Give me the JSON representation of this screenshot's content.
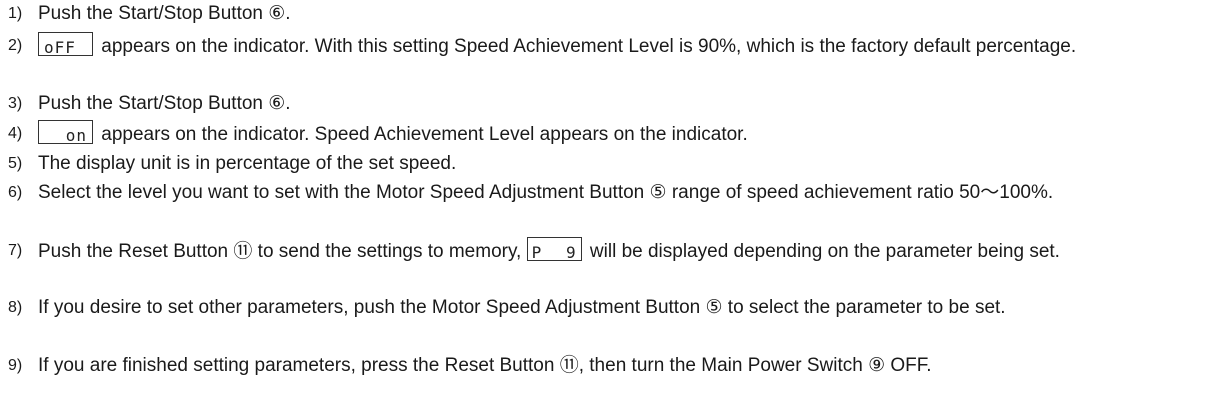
{
  "steps": [
    {
      "num": "1)",
      "text": "Push the Start/Stop Button ⑥."
    },
    {
      "num": "2)",
      "indicator": "oFF",
      "text": "appears on the indicator. With this setting Speed Achievement Level is 90%, which is the factory default percentage."
    },
    {
      "num": "3)",
      "text": "Push the Start/Stop Button ⑥."
    },
    {
      "num": "4)",
      "indicator": "on",
      "text": "appears on the indicator. Speed Achievement Level appears on the indicator."
    },
    {
      "num": "5)",
      "text": "The display unit is in percentage of the set speed."
    },
    {
      "num": "6)",
      "text": "Select the level you want to set with the Motor Speed Adjustment Button ⑤ range of speed achievement ratio 50～100%."
    },
    {
      "num": "7)",
      "text_before": "Push the Reset Button ⑪ to send the settings to memory,",
      "indicator_left": "P",
      "indicator_right": "9",
      "text_after": "will be displayed depending on the parameter being set."
    },
    {
      "num": "8)",
      "text": "If you desire to set other parameters, push the Motor Speed Adjustment Button ⑤ to select the parameter to be set."
    },
    {
      "num": "9)",
      "text": "If you are finished setting parameters, press the Reset Button ⑪, then turn the Main Power Switch ⑨ OFF."
    }
  ]
}
